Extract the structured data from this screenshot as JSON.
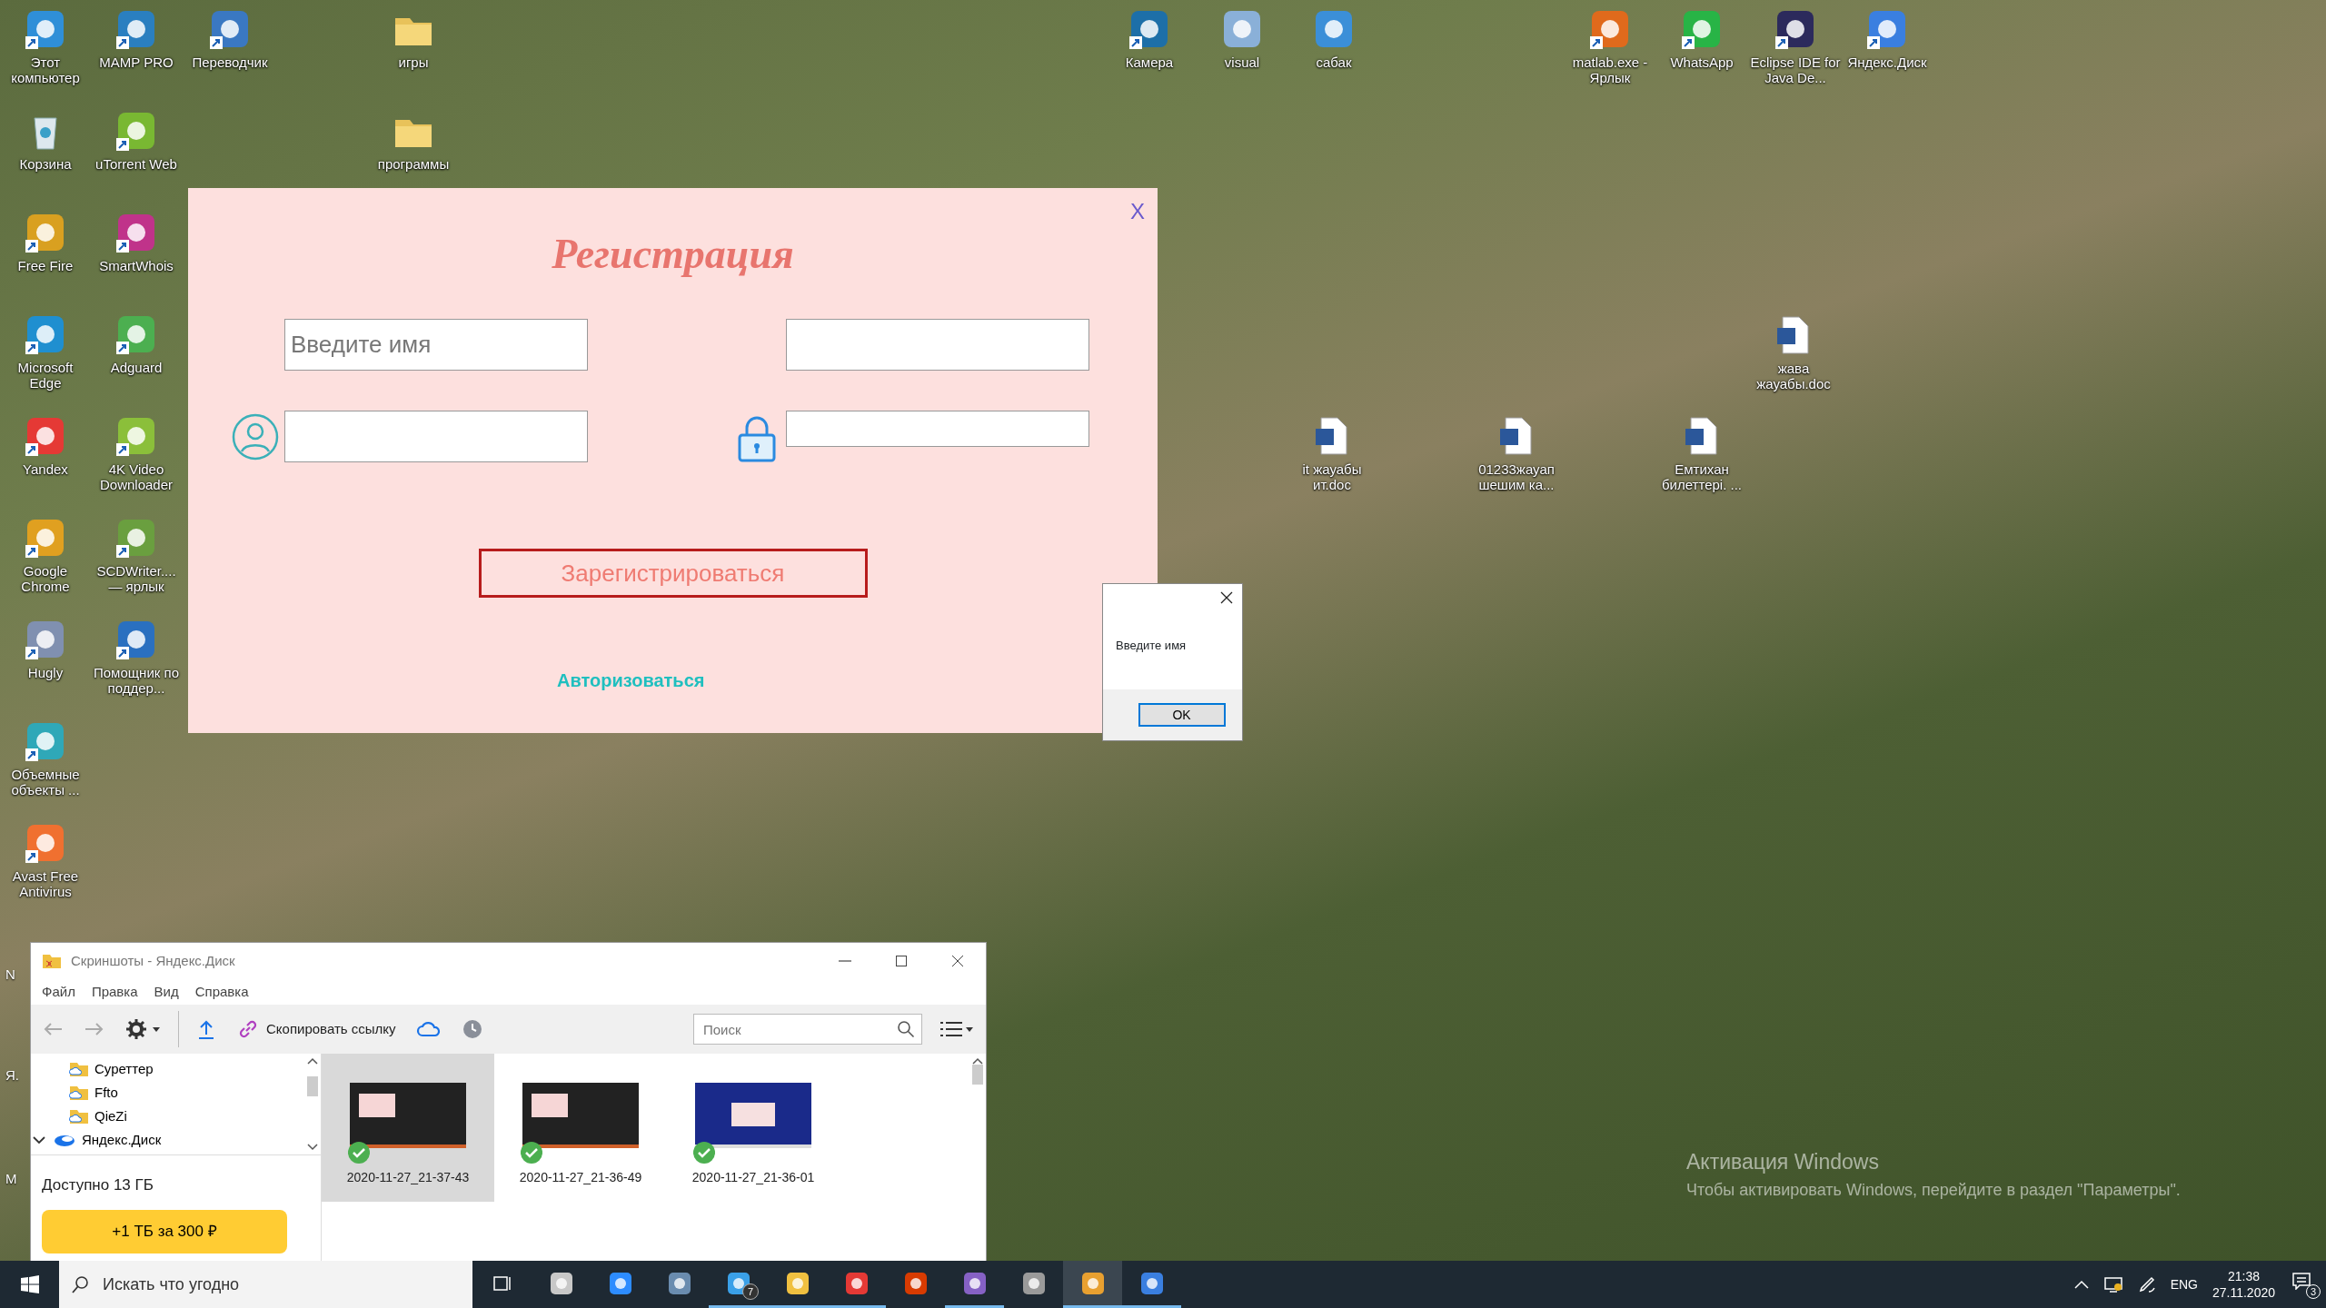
{
  "desktop_icons": [
    {
      "label": "Этот компьютер",
      "kind": "app",
      "color": "#2f8fd8",
      "shortcut": true
    },
    {
      "label": "MAMP PRO",
      "kind": "app",
      "color": "#2a7fc0",
      "shortcut": true
    },
    {
      "label": "Переводчик",
      "kind": "app",
      "color": "#3a78c2",
      "shortcut": true
    },
    {
      "label": "игры",
      "kind": "folder",
      "shortcut": false
    },
    {
      "label": "Камера",
      "kind": "app",
      "color": "#1d6fa8",
      "shortcut": true
    },
    {
      "label": "visual",
      "kind": "app",
      "color": "#8ab0d8",
      "shortcut": false
    },
    {
      "label": "сабак",
      "kind": "app",
      "color": "#3b8fd8",
      "shortcut": false
    },
    {
      "label": "matlab.exe - Ярлык",
      "kind": "app",
      "color": "#e06a1c",
      "shortcut": true
    },
    {
      "label": "WhatsApp",
      "kind": "app",
      "color": "#28b446",
      "shortcut": true
    },
    {
      "label": "Eclipse IDE for Java De...",
      "kind": "app",
      "color": "#2c2a5c",
      "shortcut": true
    },
    {
      "label": "Яндекс.Диск",
      "kind": "app",
      "color": "#3a7fe0",
      "shortcut": true
    },
    {
      "label": "Корзина",
      "kind": "bin",
      "shortcut": false
    },
    {
      "label": "uTorrent Web",
      "kind": "app",
      "color": "#79b832",
      "shortcut": true
    },
    {
      "label": "программы",
      "kind": "folder",
      "shortcut": false
    },
    {
      "label": "Free Fire",
      "kind": "app",
      "color": "#d9a020",
      "shortcut": true
    },
    {
      "label": "SmartWhois",
      "kind": "app",
      "color": "#c0338a",
      "shortcut": true
    },
    {
      "label": "Microsoft Edge",
      "kind": "app",
      "color": "#1f8fd0",
      "shortcut": true
    },
    {
      "label": "Adguard",
      "kind": "app",
      "color": "#4caf50",
      "shortcut": true
    },
    {
      "label": "жава жауабы.doc",
      "kind": "doc",
      "shortcut": false
    },
    {
      "label": "Yandex",
      "kind": "app",
      "color": "#e53935",
      "shortcut": true
    },
    {
      "label": "4K Video Downloader",
      "kind": "app",
      "color": "#8bbf3a",
      "shortcut": true
    },
    {
      "label": "it жауабы ит.doc",
      "kind": "doc",
      "shortcut": false
    },
    {
      "label": "01233жауап шешим ка...",
      "kind": "doc",
      "shortcut": false
    },
    {
      "label": "Емтихан билеттері. ...",
      "kind": "doc",
      "shortcut": false
    },
    {
      "label": "Google Chrome",
      "kind": "app",
      "color": "#e0a020",
      "shortcut": true
    },
    {
      "label": "SCDWriter.... — ярлык",
      "kind": "app",
      "color": "#6a9f3f",
      "shortcut": true
    },
    {
      "label": "Hugly",
      "kind": "app",
      "color": "#8090b0",
      "shortcut": true
    },
    {
      "label": "Помощник по поддер...",
      "kind": "app",
      "color": "#2a70c0",
      "shortcut": true
    },
    {
      "label": "Объемные объекты ...",
      "kind": "app",
      "color": "#2fa8b8",
      "shortcut": true
    },
    {
      "label": "Avast Free Antivirus",
      "kind": "app",
      "color": "#f07030",
      "shortcut": true
    }
  ],
  "edge_labels": [
    "N",
    "Я.",
    "M"
  ],
  "registration": {
    "title": "Регистрация",
    "close": "X",
    "fields": [
      {
        "placeholder": "Введите имя",
        "kind": "name"
      },
      {
        "kind": "plain"
      },
      {
        "kind": "login"
      },
      {
        "kind": "password"
      }
    ],
    "submit": "Зарегистрироваться",
    "link": "Авторизоваться"
  },
  "message_box": {
    "text": "Введите имя",
    "button": "OK"
  },
  "explorer": {
    "title": "Скриншоты - Яндекс.Диск",
    "menu": [
      "Файл",
      "Правка",
      "Вид",
      "Справка"
    ],
    "toolbar": {
      "copy_link": "Скопировать ссылку",
      "search_placeholder": "Поиск"
    },
    "tree": [
      {
        "label": "Суреттер",
        "kind": "folder",
        "expanded": false
      },
      {
        "label": "Ffto",
        "kind": "folder",
        "expanded": false
      },
      {
        "label": "QieZi",
        "kind": "folder",
        "expanded": false
      },
      {
        "label": "Яндекс.Диск",
        "kind": "drive",
        "expanded": true
      }
    ],
    "storage": "Доступно 13 ГБ",
    "upgrade": "+1 ТБ за 300 ₽",
    "files": [
      {
        "name": "2020-11-27_21-37-43",
        "kind": "dark",
        "selected": true,
        "synced": true
      },
      {
        "name": "2020-11-27_21-36-49",
        "kind": "dark",
        "selected": false,
        "synced": true
      },
      {
        "name": "2020-11-27_21-36-01",
        "kind": "blue",
        "selected": false,
        "synced": true
      }
    ]
  },
  "activation": {
    "title": "Активация Windows",
    "text": "Чтобы активировать Windows, перейдите в раздел \"Параметры\"."
  },
  "taskbar": {
    "search_placeholder": "Искать что угодно",
    "apps": [
      {
        "color": "#c8c8c8",
        "running": false,
        "selected": false
      },
      {
        "color": "#2d8cff",
        "running": false,
        "selected": false
      },
      {
        "color": "#6a8caf",
        "running": false,
        "selected": false
      },
      {
        "color": "#3aa0e8",
        "running": true,
        "selected": false,
        "badge": "7"
      },
      {
        "color": "#f0c040",
        "running": true,
        "selected": false
      },
      {
        "color": "#e53935",
        "running": true,
        "selected": false
      },
      {
        "color": "#d83b01",
        "running": false,
        "selected": false
      },
      {
        "color": "#8661c5",
        "running": true,
        "selected": false
      },
      {
        "color": "#9a9a9a",
        "running": false,
        "selected": false
      },
      {
        "color": "#e8a030",
        "running": true,
        "selected": true
      },
      {
        "color": "#3a7fe0",
        "running": true,
        "selected": false
      }
    ],
    "language": "ENG",
    "time": "21:38",
    "date": "27.11.2020",
    "notifications": "3"
  }
}
